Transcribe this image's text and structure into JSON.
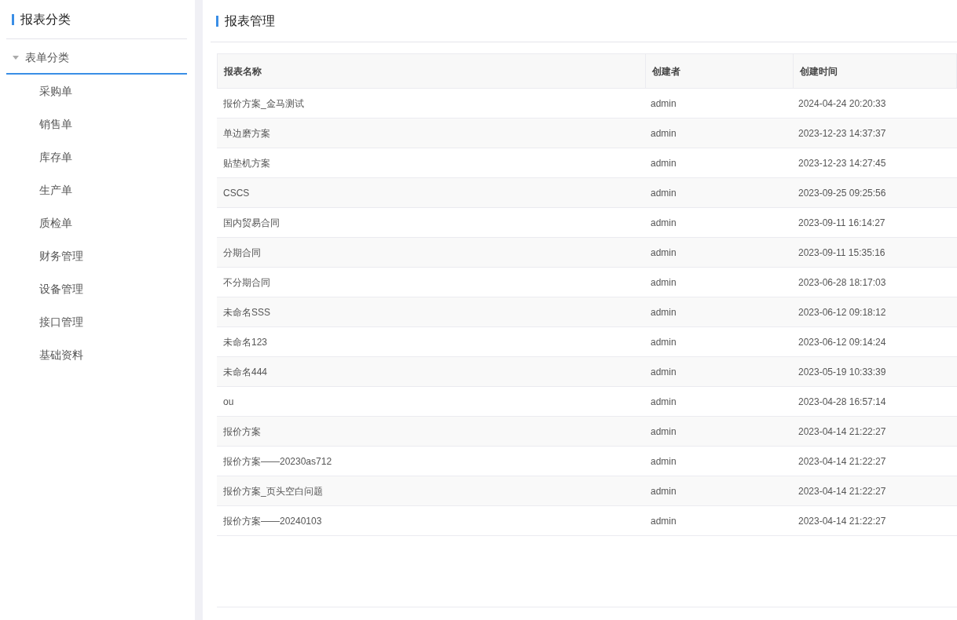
{
  "sidebar": {
    "title": "报表分类",
    "tree": [
      {
        "label": "表单分类",
        "expanded": true,
        "selected": true,
        "children": [
          {
            "label": "采购单",
            "selected": false
          },
          {
            "label": "销售单",
            "selected": false
          },
          {
            "label": "库存单",
            "selected": false
          },
          {
            "label": "生产单",
            "selected": false
          },
          {
            "label": "质检单",
            "selected": false
          },
          {
            "label": "财务管理",
            "selected": false
          },
          {
            "label": "设备管理",
            "selected": false
          },
          {
            "label": "接口管理",
            "selected": false
          },
          {
            "label": "基础资料",
            "selected": false
          }
        ]
      }
    ]
  },
  "main": {
    "title": "报表管理",
    "table": {
      "columns": [
        "报表名称",
        "创建者",
        "创建时间"
      ],
      "rows": [
        [
          "报价方案_金马测试",
          "admin",
          "2024-04-24 20:20:33"
        ],
        [
          "单边磨方案",
          "admin",
          "2023-12-23 14:37:37"
        ],
        [
          "贴垫机方案",
          "admin",
          "2023-12-23 14:27:45"
        ],
        [
          "CSCS",
          "admin",
          "2023-09-25 09:25:56"
        ],
        [
          "国内贸易合同",
          "admin",
          "2023-09-11 16:14:27"
        ],
        [
          "分期合同",
          "admin",
          "2023-09-11 15:35:16"
        ],
        [
          "不分期合同",
          "admin",
          "2023-06-28 18:17:03"
        ],
        [
          "未命名SSS",
          "admin",
          "2023-06-12 09:18:12"
        ],
        [
          "未命名123",
          "admin",
          "2023-06-12 09:14:24"
        ],
        [
          "未命名444",
          "admin",
          "2023-05-19 10:33:39"
        ],
        [
          "ou",
          "admin",
          "2023-04-28 16:57:14"
        ],
        [
          "报价方案",
          "admin",
          "2023-04-14 21:22:27"
        ],
        [
          "报价方案——20230as712",
          "admin",
          "2023-04-14 21:22:27"
        ],
        [
          "报价方案_页头空白问题",
          "admin",
          "2023-04-14 21:22:27"
        ],
        [
          "报价方案——20240103",
          "admin",
          "2023-04-14 21:22:27"
        ]
      ]
    }
  }
}
